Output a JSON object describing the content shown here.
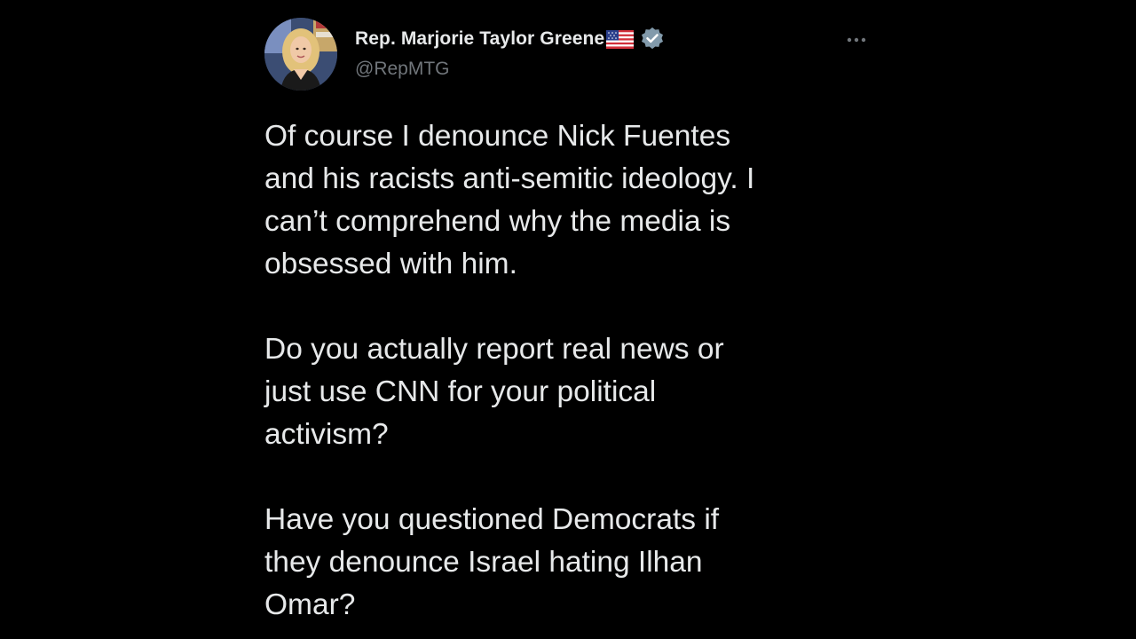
{
  "author": {
    "display_name": "Rep. Marjorie Taylor Greene",
    "handle": "@RepMTG",
    "badges": [
      "us-flag-icon",
      "verified-badge-icon"
    ],
    "avatar": "avatar"
  },
  "menu": {
    "icon": "more-options-icon"
  },
  "tweet": {
    "paragraphs": [
      "Of course I denounce Nick Fuentes\nand his racists anti-semitic ideology. I\ncan’t comprehend why the media is\nobsessed with him.",
      "Do you actually report real news or\njust use CNN for your political\nactivism?",
      "Have you questioned Democrats if\nthey denounce Israel hating Ilhan\nOmar?"
    ]
  },
  "colors": {
    "background": "#000000",
    "text_primary": "#e7e9ea",
    "text_secondary": "#71767b",
    "verified_badge": "#829aab"
  }
}
